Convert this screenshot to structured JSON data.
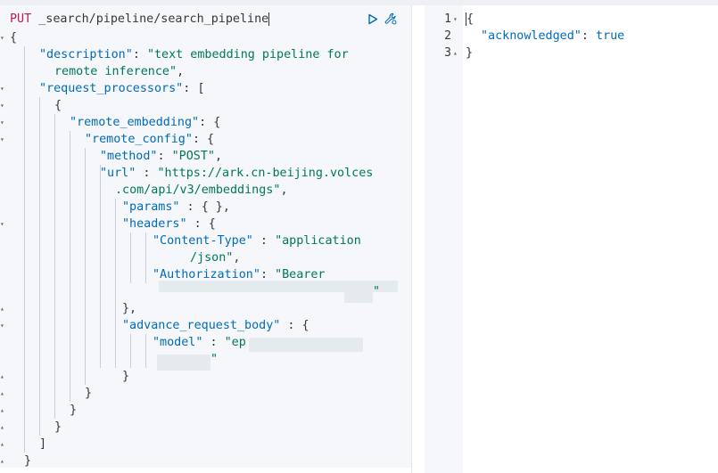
{
  "request": {
    "method": "PUT",
    "path": "_search/pipeline/search_pipeline"
  },
  "editor": {
    "open_brace": "{",
    "close_brace": "}",
    "description_key": "\"description\"",
    "description_value_1": "\"text embedding pipeline for",
    "description_value_2": "remote inference\"",
    "request_processors_key": "\"request_processors\"",
    "remote_embedding_key": "\"remote_embedding\"",
    "remote_config_key": "\"remote_config\"",
    "method_key": "\"method\"",
    "method_value": "\"POST\"",
    "url_key": "\"url\"",
    "url_value_1": "\"https://ark.cn-beijing.volces",
    "url_value_2": ".com/api/v3/embeddings\"",
    "params_key": "\"params\"",
    "params_value": "{ }",
    "headers_key": "\"headers\"",
    "content_type_key": "\"Content-Type\"",
    "content_type_value_1": "\"application",
    "content_type_value_2": "/json\"",
    "authorization_key": "\"Authorization\"",
    "authorization_value_1": "\"Bearer",
    "authorization_value_end": "\"",
    "advance_request_body_key": "\"advance_request_body\"",
    "model_key": "\"model\"",
    "model_value_start": "\"ep",
    "model_value_end": "\""
  },
  "response": {
    "line_numbers": [
      "1",
      "2",
      "3"
    ],
    "open_brace": "{",
    "acknowledged_key": "\"acknowledged\"",
    "acknowledged_value": "true",
    "close_brace": "}"
  },
  "icons": {
    "run": "play-icon",
    "settings": "wrench-icon"
  },
  "colors": {
    "method": "#c2185b",
    "key": "#006bb8",
    "string": "#00785a",
    "editor_bg": "#f5f7fa"
  }
}
